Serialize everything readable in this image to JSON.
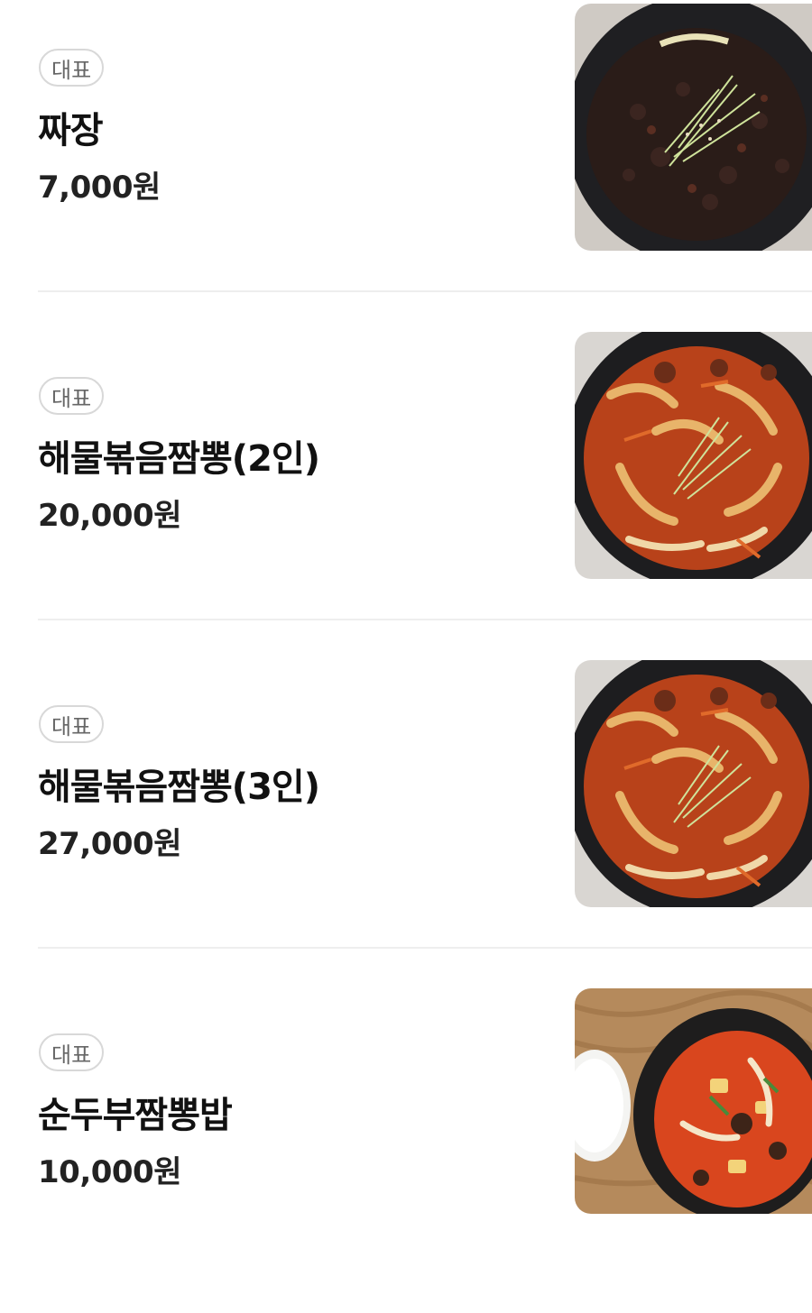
{
  "menu": {
    "items": [
      {
        "badge": "대표",
        "name": "짜장",
        "price": "7,000원",
        "image": "jjajang-photo"
      },
      {
        "badge": "대표",
        "name": "해물볶음짬뽕(2인)",
        "price": "20,000원",
        "image": "seafood-jjamppong-photo"
      },
      {
        "badge": "대표",
        "name": "해물볶음짬뽕(3인)",
        "price": "27,000원",
        "image": "seafood-jjamppong-photo"
      },
      {
        "badge": "대표",
        "name": "순두부짬뽕밥",
        "price": "10,000원",
        "image": "sundubu-jjamppong-bap-photo"
      }
    ]
  },
  "colors": {
    "badge_border": "#d8d8d8",
    "divider": "#eeeeee",
    "text": "#111111"
  }
}
